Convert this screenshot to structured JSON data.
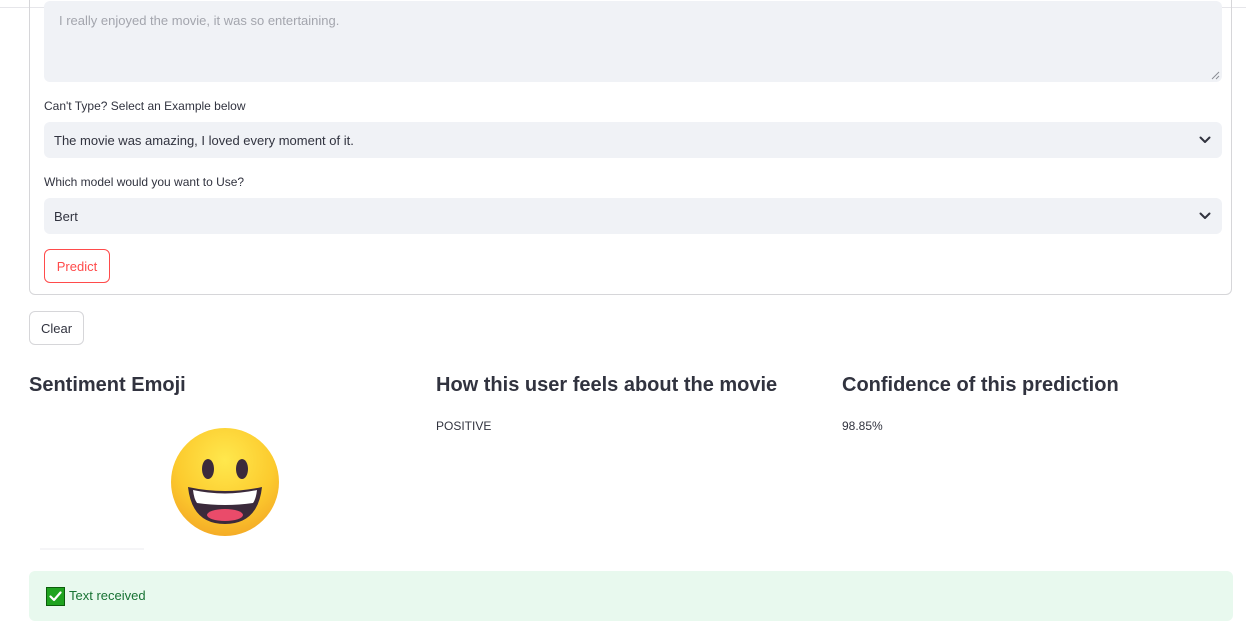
{
  "review_input": {
    "placeholder": "I really enjoyed the movie, it was so entertaining."
  },
  "example_select": {
    "label": "Can't Type? Select an Example below",
    "selected": "The movie was amazing, I loved every moment of it."
  },
  "model_select": {
    "label": "Which model would you want to Use?",
    "selected": "Bert"
  },
  "buttons": {
    "predict": "Predict",
    "clear": "Clear"
  },
  "results": {
    "emoji_heading": "Sentiment Emoji",
    "emoji_icon": "grinning-face-emoji",
    "feeling_heading": "How this user feels about the movie",
    "feeling_value": "POSITIVE",
    "confidence_heading": "Confidence of this prediction",
    "confidence_value": "98.85%"
  },
  "status": {
    "icon": "check-mark-icon",
    "message": "Text received",
    "color": "#177233"
  },
  "colors": {
    "accent": "#ff4b4b",
    "input_bg": "#f0f2f6",
    "success_bg": "#e8f9ee"
  }
}
